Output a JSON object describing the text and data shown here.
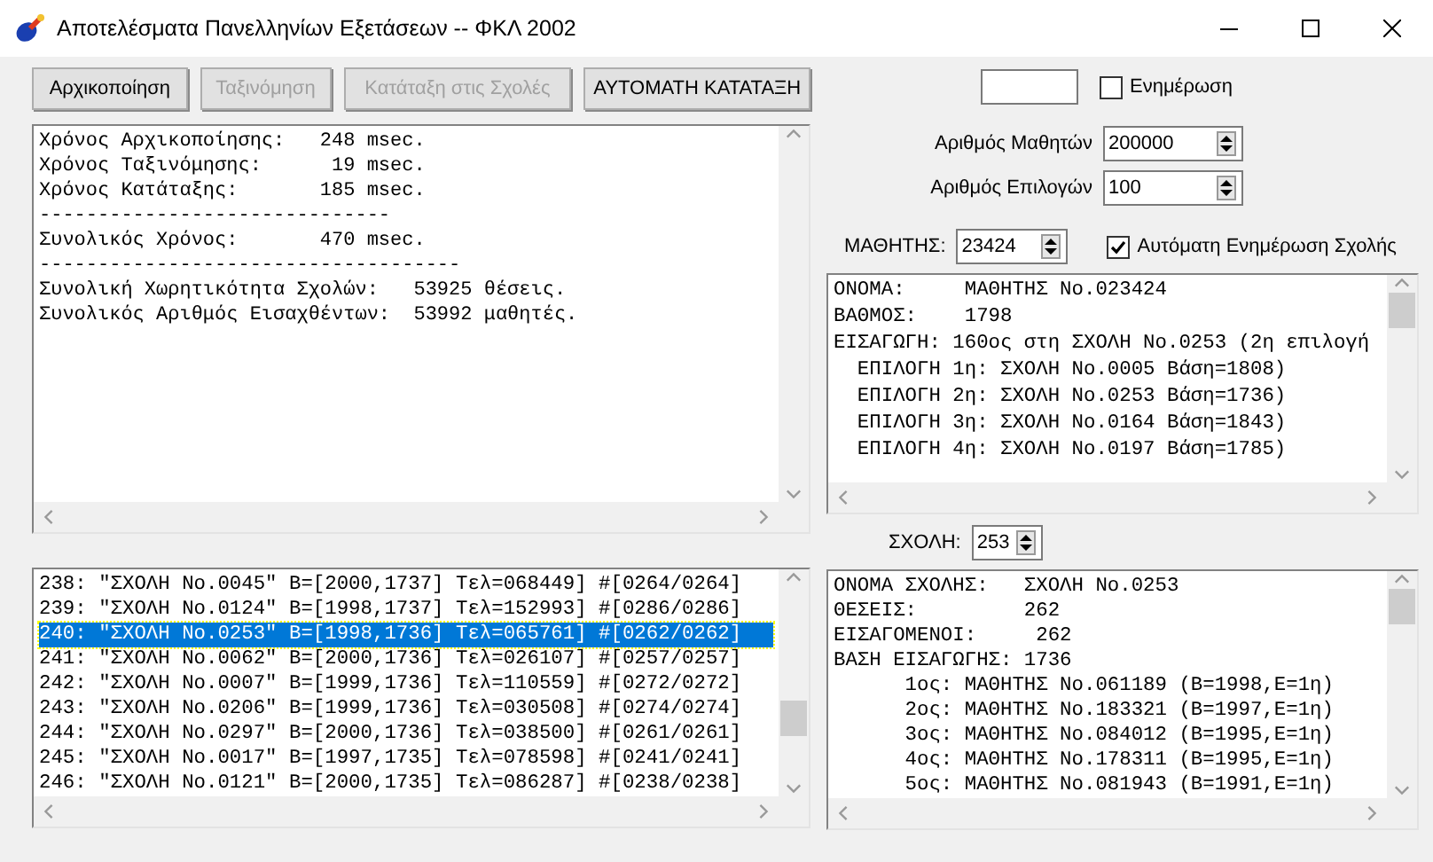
{
  "window": {
    "title": "Αποτελέσματα Πανελληνίων Εξετάσεων -- ΦΚΛ 2002"
  },
  "buttons": [
    {
      "label": "Αρχικοποίηση",
      "disabled": false
    },
    {
      "label": "Ταξινόμηση",
      "disabled": true
    },
    {
      "label": "Κατάταξη στις Σχολές",
      "disabled": true
    },
    {
      "label": "ΑΥΤΟΜΑΤΗ ΚΑΤΑΤΑΞΗ",
      "disabled": false
    }
  ],
  "output_log": {
    "lines": [
      "Χρόνος Αρχικοποίησης:   248 msec.",
      "Χρόνος Ταξινόμησης:      19 msec.",
      "Χρόνος Κατάταξης:       185 msec.",
      "------------------------------",
      "Συνολικός Χρόνος:       470 msec.",
      "------------------------------------",
      "Συνολική Χωρητικότητα Σχολών:   53925 θέσεις.",
      "Συνολικός Αριθμός Εισαχθέντων:  53992 μαθητές."
    ]
  },
  "school_list": {
    "rows": [
      {
        "text": "238: \"ΣΧΟΛΗ No.0045\" B=[2000,1737] Τελ=068449] #[0264/0264]",
        "selected": false
      },
      {
        "text": "239: \"ΣΧΟΛΗ No.0124\" B=[1998,1737] Τελ=152993] #[0286/0286]",
        "selected": false
      },
      {
        "text": "240: \"ΣΧΟΛΗ No.0253\" B=[1998,1736] Τελ=065761] #[0262/0262]",
        "selected": true
      },
      {
        "text": "241: \"ΣΧΟΛΗ No.0062\" B=[2000,1736] Τελ=026107] #[0257/0257]",
        "selected": false
      },
      {
        "text": "242: \"ΣΧΟΛΗ No.0007\" B=[1999,1736] Τελ=110559] #[0272/0272]",
        "selected": false
      },
      {
        "text": "243: \"ΣΧΟΛΗ No.0206\" B=[1999,1736] Τελ=030508] #[0274/0274]",
        "selected": false
      },
      {
        "text": "244: \"ΣΧΟΛΗ No.0297\" B=[2000,1736] Τελ=038500] #[0261/0261]",
        "selected": false
      },
      {
        "text": "245: \"ΣΧΟΛΗ No.0017\" B=[1997,1735] Τελ=078598] #[0241/0241]",
        "selected": false
      },
      {
        "text": "246: \"ΣΧΟΛΗ No.0121\" B=[2000,1735] Τελ=086287] #[0238/0238]",
        "selected": false
      }
    ]
  },
  "update": {
    "label": "Ενημέρωση",
    "checked": false
  },
  "num_students": {
    "label": "Αριθμός Μαθητών",
    "value": "200000"
  },
  "num_choices": {
    "label": "Αριθμός Επιλογών",
    "value": "100"
  },
  "student": {
    "label": "ΜΑΘΗΤΗΣ:",
    "value": "23424"
  },
  "auto_update": {
    "label": "Αυτόματη Ενημέρωση Σχολής",
    "checked": true
  },
  "student_info": {
    "lines": [
      "ΟΝΟΜΑ:     ΜΑΘΗΤΗΣ No.023424",
      "ΒΑΘΜΟΣ:    1798",
      "ΕΙΣΑΓΩΓΗ: 160ος στη ΣΧΟΛΗ No.0253 (2η επιλογή",
      "  ΕΠΙΛΟΓΗ 1η: ΣΧΟΛΗ No.0005 Βάση=1808)",
      "  ΕΠΙΛΟΓΗ 2η: ΣΧΟΛΗ No.0253 Βάση=1736)",
      "  ΕΠΙΛΟΓΗ 3η: ΣΧΟΛΗ No.0164 Βάση=1843)",
      "  ΕΠΙΛΟΓΗ 4η: ΣΧΟΛΗ No.0197 Βάση=1785)"
    ]
  },
  "school": {
    "label": "ΣΧΟΛΗ:",
    "value": "253"
  },
  "school_info": {
    "lines": [
      "ΟΝΟΜΑ ΣΧΟΛΗΣ:   ΣΧΟΛΗ No.0253",
      "ΘΕΣΕΙΣ:         262",
      "ΕΙΣΑΓΟΜΕΝΟΙ:     262",
      "ΒΑΣΗ ΕΙΣΑΓΩΓΗΣ: 1736",
      "      1ος: ΜΑΘΗΤΗΣ No.061189 (B=1998,E=1η)",
      "      2ος: ΜΑΘΗΤΗΣ No.183321 (B=1997,E=1η)",
      "      3ος: ΜΑΘΗΤΗΣ No.084012 (B=1995,E=1η)",
      "      4ος: ΜΑΘΗΤΗΣ No.178311 (B=1995,E=1η)",
      "      5ος: ΜΑΘΗΤΗΣ No.081943 (B=1991,E=1η)"
    ]
  }
}
